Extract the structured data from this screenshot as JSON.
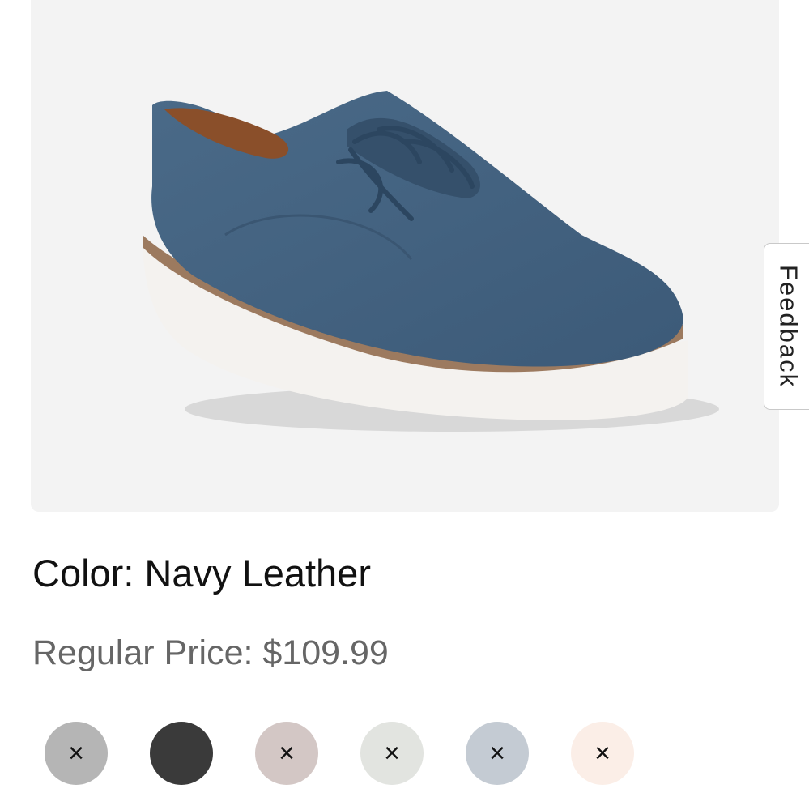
{
  "product": {
    "image_icon": "shoe-oxford-icon",
    "color_label": "Color: Navy Leather",
    "price_label": "Regular Price: $109.99"
  },
  "feedback": {
    "label": "Feedback"
  },
  "swatches": [
    {
      "color": "#b5b5b5",
      "unavailable": true,
      "mark": "×"
    },
    {
      "color": "#3a3a3a",
      "unavailable": false,
      "mark": ""
    },
    {
      "color": "#d3c7c5",
      "unavailable": true,
      "mark": "×"
    },
    {
      "color": "#e2e4e0",
      "unavailable": true,
      "mark": "×"
    },
    {
      "color": "#c4cbd3",
      "unavailable": true,
      "mark": "×"
    },
    {
      "color": "#fbeee7",
      "unavailable": true,
      "mark": "×"
    }
  ]
}
